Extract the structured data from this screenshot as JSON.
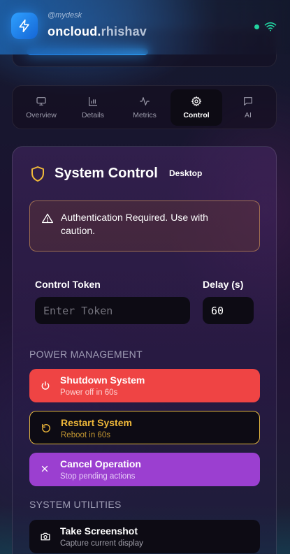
{
  "header": {
    "user": "@mydesk",
    "host_main": "oncloud.",
    "host_domain": "rhishav",
    "status_color": "#22d3a0",
    "icons": [
      "bolt-icon",
      "wifi-icon"
    ]
  },
  "tabs": [
    {
      "label": "Overview",
      "icon": "monitor-icon",
      "active": false
    },
    {
      "label": "Details",
      "icon": "bar-chart-icon",
      "active": false
    },
    {
      "label": "Metrics",
      "icon": "activity-icon",
      "active": false
    },
    {
      "label": "Control",
      "icon": "gear-icon",
      "active": true
    },
    {
      "label": "AI",
      "icon": "chat-icon",
      "active": false
    }
  ],
  "control": {
    "title": "System Control",
    "mode": "Desktop",
    "alert": "Authentication Required. Use with caution.",
    "token_label": "Control Token",
    "token_placeholder": "Enter Token",
    "delay_label": "Delay (s)",
    "delay_value": "60"
  },
  "power": {
    "heading": "POWER MANAGEMENT",
    "shutdown": {
      "title": "Shutdown System",
      "subtitle": "Power off in 60s",
      "color": "#ef4444"
    },
    "restart": {
      "title": "Restart System",
      "subtitle": "Reboot in 60s",
      "color": "#f0b93a"
    },
    "cancel": {
      "title": "Cancel Operation",
      "subtitle": "Stop pending actions",
      "color": "#9b3fd0"
    }
  },
  "utilities": {
    "heading": "SYSTEM UTILITIES",
    "screenshot": {
      "title": "Take Screenshot",
      "subtitle": "Capture current display"
    }
  }
}
